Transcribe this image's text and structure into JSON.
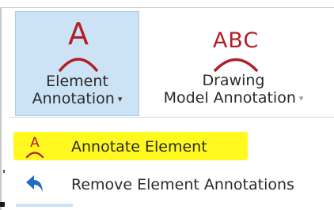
{
  "ribbon": {
    "element_annotation": {
      "line1": "Element",
      "line2": "Annotation",
      "caret": "▾",
      "icon": "annotate-element-icon",
      "pressed": true
    },
    "drawing_model_annotation": {
      "line1": "Drawing",
      "line2": "Model Annotation",
      "caret": "▾",
      "icon": "annotate-abc-icon",
      "pressed": false
    }
  },
  "menu": {
    "items": [
      {
        "label": "Annotate Element",
        "icon": "annotate-element-icon",
        "highlighted": true
      },
      {
        "label": "Remove Element Annotations",
        "icon": "undo-arrow-icon",
        "highlighted": false
      }
    ]
  },
  "colors": {
    "icon_red": "#b21f24",
    "pressed_bg": "#cce3f5",
    "highlight": "#fff91f",
    "arrow_blue": "#1f6ec2"
  }
}
